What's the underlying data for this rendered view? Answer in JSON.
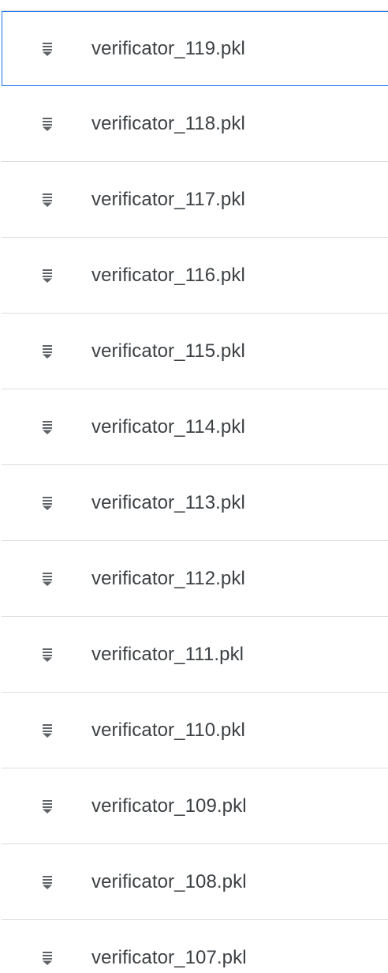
{
  "file_list": {
    "icon": "file-download-icon",
    "selected_index": 0,
    "colors": {
      "text": "#3c4043",
      "icon": "#5f6368",
      "divider": "#dadce0",
      "selected_border": "#1a73e8"
    },
    "items": [
      {
        "name": "verificator_119.pkl"
      },
      {
        "name": "verificator_118.pkl"
      },
      {
        "name": "verificator_117.pkl"
      },
      {
        "name": "verificator_116.pkl"
      },
      {
        "name": "verificator_115.pkl"
      },
      {
        "name": "verificator_114.pkl"
      },
      {
        "name": "verificator_113.pkl"
      },
      {
        "name": "verificator_112.pkl"
      },
      {
        "name": "verificator_111.pkl"
      },
      {
        "name": "verificator_110.pkl"
      },
      {
        "name": "verificator_109.pkl"
      },
      {
        "name": "verificator_108.pkl"
      },
      {
        "name": "verificator_107.pkl"
      }
    ]
  }
}
